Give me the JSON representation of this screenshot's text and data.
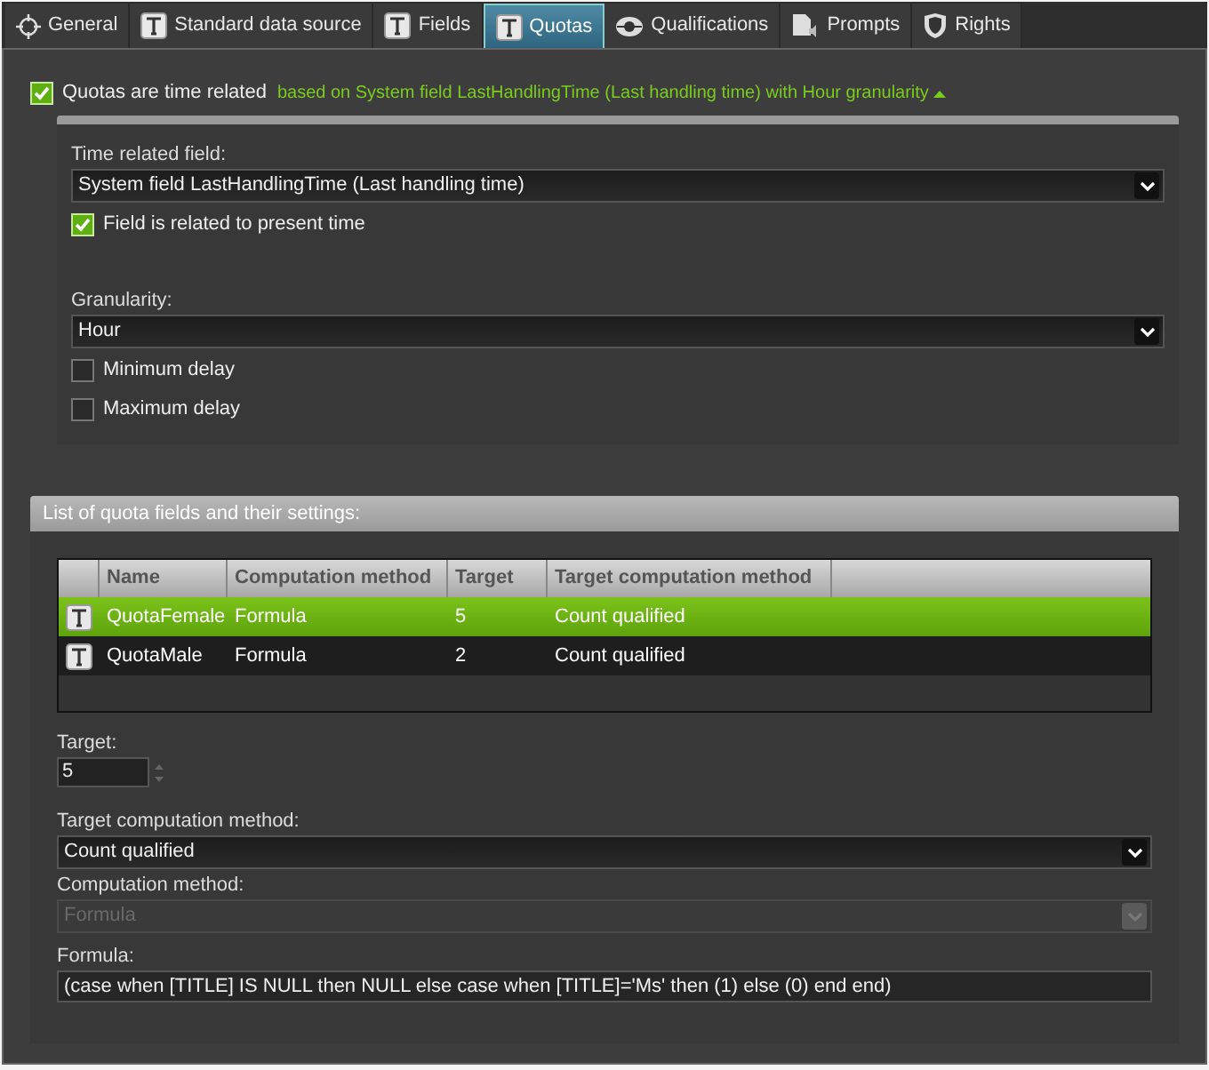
{
  "tabs": [
    {
      "label": "General",
      "selected": false
    },
    {
      "label": "Standard data source",
      "selected": false
    },
    {
      "label": "Fields",
      "selected": false
    },
    {
      "label": "Quotas",
      "selected": true
    },
    {
      "label": "Qualifications",
      "selected": false
    },
    {
      "label": "Prompts",
      "selected": false
    },
    {
      "label": "Rights",
      "selected": false
    }
  ],
  "time_related": {
    "label": "Quotas are time related",
    "checked": true,
    "summary": "based on System field LastHandlingTime (Last handling time) with Hour granularity",
    "expanded": true
  },
  "time_settings": [
    {
      "kind": "select",
      "label": "Time related field:",
      "value": "System field LastHandlingTime (Last handling time)",
      "disabled": false
    },
    {
      "kind": "checkbox",
      "label": "Field is related to present time",
      "checked": true
    },
    {
      "kind": "spacer"
    },
    {
      "kind": "select",
      "label": "Granularity:",
      "value": "Hour",
      "disabled": false
    },
    {
      "kind": "checkbox",
      "label": "Minimum delay",
      "checked": false
    },
    {
      "kind": "checkbox",
      "label": "Maximum delay",
      "checked": false
    }
  ],
  "quota_section": {
    "title": "List of quota fields and their settings:"
  },
  "table": {
    "columns": [
      "Name",
      "Computation method",
      "Target",
      "Target computation method"
    ],
    "rows": [
      {
        "cells": [
          "QuotaFemale",
          "Formula",
          "5",
          "Count qualified"
        ],
        "selected": true
      },
      {
        "cells": [
          "QuotaMale",
          "Formula",
          "2",
          "Count qualified"
        ],
        "selected": false
      }
    ]
  },
  "quota_settings": [
    {
      "kind": "spin",
      "label": "Target:",
      "value": "5"
    },
    {
      "kind": "select",
      "label": "Target computation method:",
      "value": "Count qualified",
      "disabled": false
    },
    {
      "kind": "select",
      "label": "Computation method:",
      "value": "Formula",
      "disabled": true
    },
    {
      "kind": "text",
      "label": "Formula:",
      "value": "(case when [TITLE] IS NULL then NULL else case when [TITLE]='Ms' then (1) else (0) end end)"
    }
  ]
}
